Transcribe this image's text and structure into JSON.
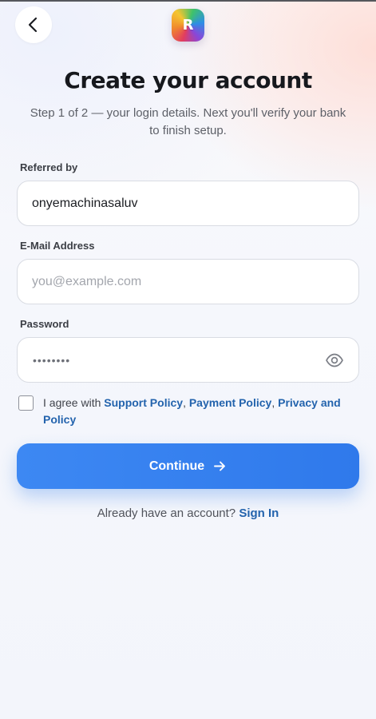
{
  "header": {
    "back_icon": "chevron-left-icon",
    "logo_letter": "R"
  },
  "page": {
    "title": "Create your account",
    "subtitle": "Step 1 of 2 — your login details. Next you'll verify your bank to finish setup."
  },
  "form": {
    "referred_by": {
      "label": "Referred by",
      "value": "onyemachinasaluv"
    },
    "email": {
      "label": "E-Mail Address",
      "value": "",
      "placeholder": "you@example.com"
    },
    "password": {
      "label": "Password",
      "masked_value": "••••••••",
      "toggle_icon": "eye-icon"
    }
  },
  "agreement": {
    "prefix": "I agree with ",
    "support_policy": "Support Policy",
    "separator_1": ", ",
    "payment_policy": "Payment Policy",
    "separator_2": ", ",
    "privacy_policy": "Privacy and Policy",
    "checked": false
  },
  "actions": {
    "continue_label": "Continue",
    "continue_icon": "arrow-right-icon"
  },
  "signin": {
    "prompt": "Already have an account? ",
    "link": "Sign In"
  },
  "colors": {
    "accent": "#2f79eb",
    "link": "#2363ad",
    "title": "#16181d"
  }
}
